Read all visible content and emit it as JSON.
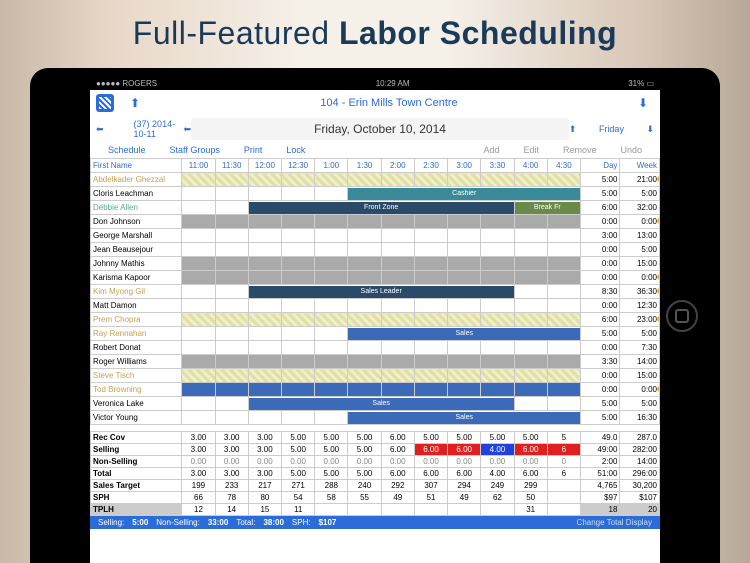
{
  "headline": {
    "pre": "Full-Featured ",
    "bold": "Labor Scheduling"
  },
  "status": {
    "carrier": "●●●●● ROGERS",
    "wifi": "⚞",
    "time": "10:29 AM",
    "battery": "31% ▭"
  },
  "header": {
    "location": "104 - Erin Mills Town Centre",
    "date_code": "(37) 2014-10-11",
    "date_long": "Friday, October 10, 2014",
    "day_label": "Friday"
  },
  "toolbar": {
    "schedule": "Schedule",
    "staff_groups": "Staff Groups",
    "print": "Print",
    "lock": "Lock",
    "add": "Add",
    "edit": "Edit",
    "remove": "Remove",
    "undo": "Undo"
  },
  "columns": {
    "first_name": "First Name",
    "times": [
      "11:00",
      "11:30",
      "12:00",
      "12:30",
      "1:00",
      "1:30",
      "2:00",
      "2:30",
      "3:00",
      "3:30",
      "4:00",
      "4:30"
    ],
    "day": "Day",
    "week": "Week"
  },
  "staff": [
    {
      "name": "Abdelkader Ghezzal",
      "cls": "gold",
      "hatched": true,
      "day": "5:00",
      "week": "21:00",
      "dot": true
    },
    {
      "name": "Cloris Leachman",
      "day": "5:00",
      "week": "5:00",
      "bar": {
        "from": 5,
        "to": 12,
        "cls": "b-teal",
        "label": "Cashier"
      }
    },
    {
      "name": "Debbie Allen",
      "cls": "teal",
      "day": "6:00",
      "week": "32:00",
      "bar": {
        "from": 2,
        "to": 10,
        "cls": "b-navy",
        "label": "Front Zone"
      },
      "bar2": {
        "from": 10,
        "to": 12,
        "cls": "b-green",
        "label": "Break   Fr"
      }
    },
    {
      "name": "Don Johnson",
      "gray": true,
      "day": "0:00",
      "week": "0:00",
      "dot": true
    },
    {
      "name": "George Marshall",
      "day": "3:00",
      "week": "13:00"
    },
    {
      "name": "Jean Beausejour",
      "day": "0:00",
      "week": "5:00"
    },
    {
      "name": "Johnny Mathis",
      "gray": true,
      "day": "0:00",
      "week": "15:00"
    },
    {
      "name": "Karisma Kapoor",
      "gray": true,
      "day": "0:00",
      "week": "0:00",
      "dot": true
    },
    {
      "name": "Kim Myong Gil",
      "cls": "gold",
      "day": "8:30",
      "week": "36:30",
      "bar": {
        "from": 2,
        "to": 10,
        "cls": "b-navy",
        "label": "Sales Leader"
      },
      "dot": true
    },
    {
      "name": "Matt Damon",
      "day": "0:00",
      "week": "12:30"
    },
    {
      "name": "Prem Chopra",
      "cls": "gold",
      "hatched": true,
      "day": "6:00",
      "week": "23:00",
      "dot": true
    },
    {
      "name": "Ray Rennahan",
      "cls": "gold",
      "day": "5:00",
      "week": "5:00",
      "bar": {
        "from": 5,
        "to": 12,
        "cls": "b-blue",
        "label": "Sales"
      }
    },
    {
      "name": "Robert Donat",
      "day": "0:00",
      "week": "7:30"
    },
    {
      "name": "Roger Williams",
      "gray": true,
      "day": "3:30",
      "week": "14:00"
    },
    {
      "name": "Steve Tisch",
      "cls": "gold",
      "hatched": true,
      "day": "0:00",
      "week": "15:00"
    },
    {
      "name": "Tod Browning",
      "cls": "gold",
      "blue": true,
      "day": "0:00",
      "week": "0:00",
      "dot": true
    },
    {
      "name": "Veronica Lake",
      "day": "5:00",
      "week": "5:00",
      "bar": {
        "from": 2,
        "to": 10,
        "cls": "b-blue",
        "label": "Sales"
      }
    },
    {
      "name": "Victor Young",
      "day": "5:00",
      "week": "16:30",
      "bar": {
        "from": 5,
        "to": 12,
        "cls": "b-blue",
        "label": "Sales"
      }
    }
  ],
  "metrics": [
    {
      "label": "Rec Cov",
      "v": [
        "3.00",
        "3.00",
        "3.00",
        "5.00",
        "5.00",
        "5.00",
        "6.00",
        "5.00",
        "5.00",
        "5.00",
        "5.00",
        "5"
      ],
      "d": "49.0",
      "w": "287.0"
    },
    {
      "label": "Selling",
      "v": [
        "3.00",
        "3.00",
        "3.00",
        "5.00",
        "5.00",
        "5.00",
        "6.00",
        "6.00",
        "6.00",
        "4.00",
        "6.00",
        "6"
      ],
      "d": "49:00",
      "w": "282:00",
      "red": [
        7,
        8,
        10,
        11
      ],
      "blue": [
        9
      ]
    },
    {
      "label": "Non-Selling",
      "v": [
        "0.00",
        "0.00",
        "0.00",
        "0.00",
        "0.00",
        "0.00",
        "0.00",
        "0.00",
        "0.00",
        "0.00",
        "0.00",
        "0"
      ],
      "d": "2:00",
      "w": "14:00",
      "dim": true
    },
    {
      "label": "Total",
      "v": [
        "3.00",
        "3.00",
        "3.00",
        "5.00",
        "5.00",
        "5.00",
        "6.00",
        "6.00",
        "6.00",
        "4.00",
        "6.00",
        "6"
      ],
      "d": "51:00",
      "w": "296:00"
    },
    {
      "label": "Sales Target",
      "v": [
        "199",
        "233",
        "217",
        "271",
        "288",
        "240",
        "292",
        "307",
        "294",
        "249",
        "299",
        ""
      ],
      "d": "4,765",
      "w": "30,200"
    },
    {
      "label": "SPH",
      "v": [
        "66",
        "78",
        "80",
        "54",
        "58",
        "55",
        "49",
        "51",
        "49",
        "62",
        "50",
        ""
      ],
      "d": "$97",
      "w": "$107"
    },
    {
      "label": "TPLH",
      "v": [
        "12",
        "14",
        "15",
        "11",
        "",
        "",
        "",
        "",
        "",
        "",
        "31",
        ""
      ],
      "d": "18",
      "w": "20",
      "gray": true
    }
  ],
  "summary": {
    "selling_l": "Selling:",
    "selling_v": "5:00",
    "nonselling_l": "Non-Selling:",
    "nonselling_v": "33:00",
    "total_l": "Total:",
    "total_v": "38:00",
    "sph_l": "SPH:",
    "sph_v": "$107",
    "change": "Change Total Display"
  }
}
